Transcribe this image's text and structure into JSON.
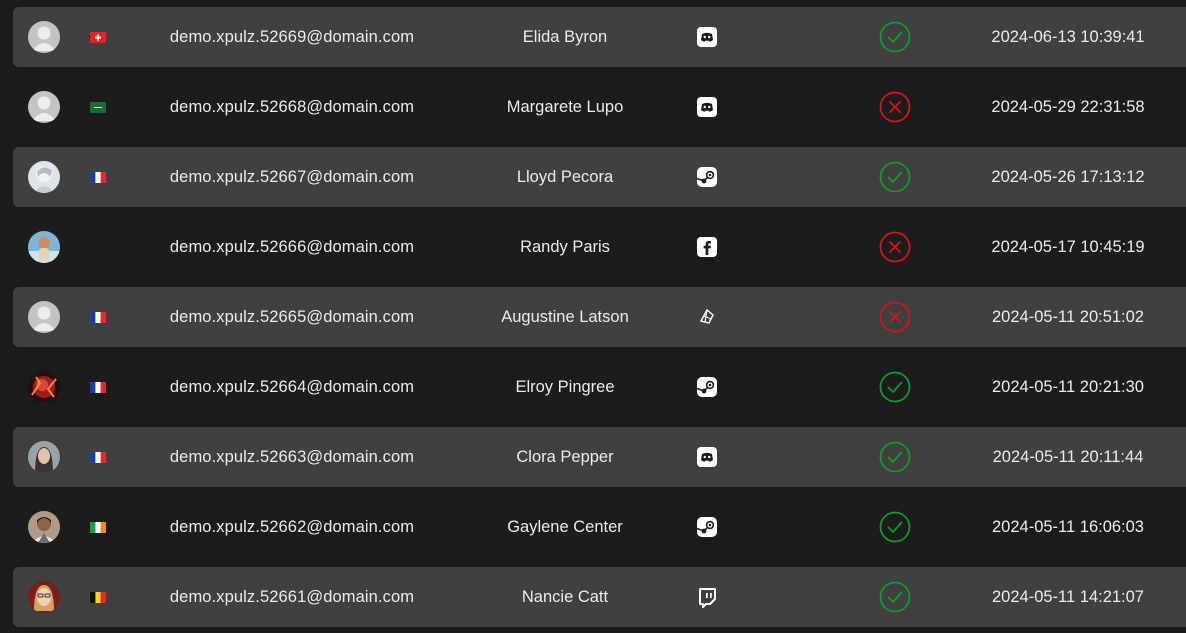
{
  "colors": {
    "ok": "#0e9c2a",
    "fail": "#d3151b",
    "stripe": "#404040",
    "background": "#1c1c1c"
  },
  "rows": [
    {
      "avatar": "default-avatar",
      "flag": "ch",
      "email": "demo.xpulz.52669@domain.com",
      "name": "Elida Byron",
      "platform": "discord",
      "verified": true,
      "date": "2024-06-13 10:39:41"
    },
    {
      "avatar": "default-avatar",
      "flag": "sa",
      "email": "demo.xpulz.52668@domain.com",
      "name": "Margarete Lupo",
      "platform": "discord",
      "verified": false,
      "date": "2024-05-29 22:31:58"
    },
    {
      "avatar": "photo-avatar",
      "flag": "fr",
      "email": "demo.xpulz.52667@domain.com",
      "name": "Lloyd Pecora",
      "platform": "steam",
      "verified": true,
      "date": "2024-05-26 17:13:12"
    },
    {
      "avatar": "photo-avatar",
      "flag": "",
      "email": "demo.xpulz.52666@domain.com",
      "name": "Randy Paris",
      "platform": "facebook",
      "verified": false,
      "date": "2024-05-17 10:45:19"
    },
    {
      "avatar": "default-avatar",
      "flag": "fr",
      "email": "demo.xpulz.52665@domain.com",
      "name": "Augustine Latson",
      "platform": "epic",
      "verified": false,
      "date": "2024-05-11 20:51:02"
    },
    {
      "avatar": "photo-avatar",
      "flag": "fr",
      "email": "demo.xpulz.52664@domain.com",
      "name": "Elroy Pingree",
      "platform": "steam",
      "verified": true,
      "date": "2024-05-11 20:21:30"
    },
    {
      "avatar": "photo-avatar",
      "flag": "fr",
      "email": "demo.xpulz.52663@domain.com",
      "name": "Clora Pepper",
      "platform": "discord",
      "verified": true,
      "date": "2024-05-11 20:11:44"
    },
    {
      "avatar": "photo-avatar",
      "flag": "ie",
      "email": "demo.xpulz.52662@domain.com",
      "name": "Gaylene Center",
      "platform": "steam",
      "verified": true,
      "date": "2024-05-11 16:06:03"
    },
    {
      "avatar": "photo-avatar",
      "flag": "be",
      "email": "demo.xpulz.52661@domain.com",
      "name": "Nancie Catt",
      "platform": "twitch",
      "verified": true,
      "date": "2024-05-11 14:21:07"
    }
  ]
}
